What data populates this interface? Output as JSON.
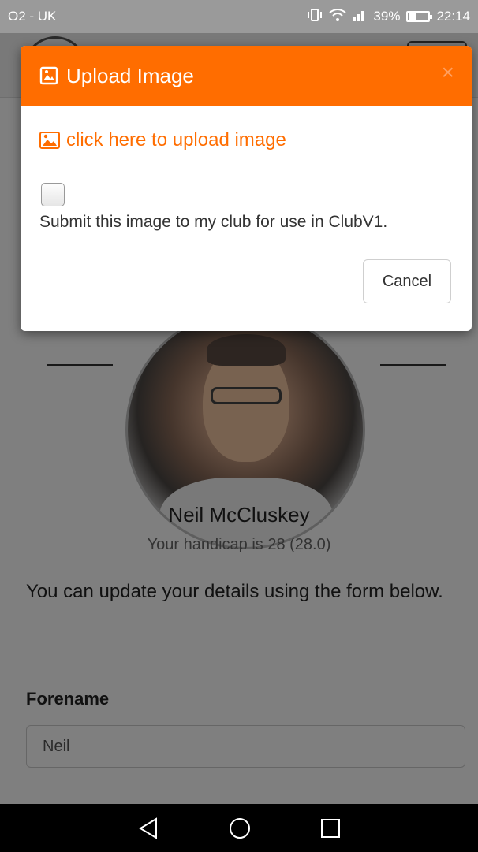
{
  "status_bar": {
    "carrier": "O2 - UK",
    "signal_battery": "39%",
    "time": "22:14"
  },
  "profile": {
    "name": "Neil McCluskey",
    "handicap_text": "Your handicap is 28 (28.0)",
    "intro_text": "You can update your details using the form below.",
    "forename_label": "Forename",
    "forename_value": "Neil"
  },
  "modal": {
    "title": "Upload Image",
    "close_symbol": "×",
    "upload_link": "click here to upload image",
    "submit_label": "Submit this image to my club for use in ClubV1.",
    "cancel_label": "Cancel"
  },
  "colors": {
    "accent": "#ff6d00"
  },
  "icons": {
    "modal_title_icon": "image-file-icon",
    "upload_link_icon": "picture-icon",
    "nav": [
      "back-icon",
      "home-icon",
      "recent-apps-icon"
    ]
  }
}
